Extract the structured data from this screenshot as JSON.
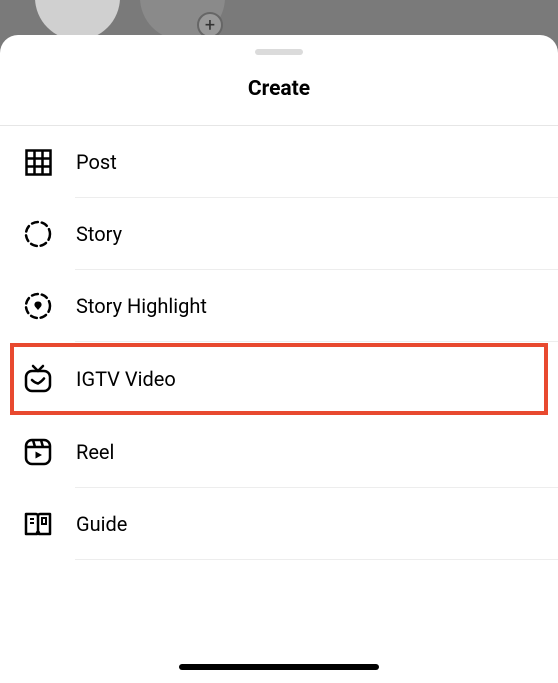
{
  "sheet": {
    "title": "Create"
  },
  "menu": {
    "items": [
      {
        "label": "Post"
      },
      {
        "label": "Story"
      },
      {
        "label": "Story Highlight"
      },
      {
        "label": "IGTV Video"
      },
      {
        "label": "Reel"
      },
      {
        "label": "Guide"
      }
    ]
  },
  "highlight_index": 3
}
